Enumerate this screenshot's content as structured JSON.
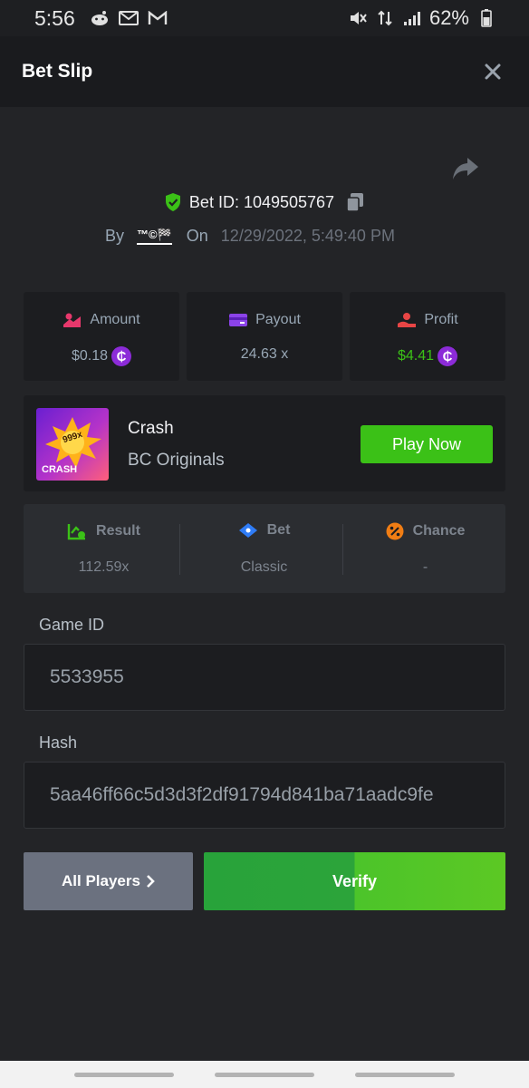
{
  "status_bar": {
    "time": "5:56",
    "battery_percent": "62%",
    "left_icons": [
      "reddit-icon",
      "gmail-icon",
      "gmail-icon"
    ],
    "right_icons": [
      "mute-icon",
      "data-icon",
      "signal-icon",
      "battery-icon"
    ]
  },
  "header": {
    "title": "Bet Slip"
  },
  "bet": {
    "id_text": "Bet ID: 1049505767",
    "by_label": "By",
    "username": "™©🏁",
    "on_label": "On",
    "date": "12/29/2022, 5:49:40 PM"
  },
  "stats": {
    "amount": {
      "label": "Amount",
      "value": "$0.18",
      "coin": "₵"
    },
    "payout": {
      "label": "Payout",
      "value": "24.63 x"
    },
    "profit": {
      "label": "Profit",
      "value": "$4.41",
      "coin": "₵"
    }
  },
  "game": {
    "name": "Crash",
    "provider": "BC Originals",
    "thumb_badge": "999x",
    "thumb_label": "CRASH",
    "play_label": "Play Now"
  },
  "result": {
    "result": {
      "label": "Result",
      "value": "112.59x"
    },
    "bet": {
      "label": "Bet",
      "value": "Classic"
    },
    "chance": {
      "label": "Chance",
      "value": "-"
    }
  },
  "game_id": {
    "label": "Game ID",
    "value": "5533955"
  },
  "hash": {
    "label": "Hash",
    "value": "5aa46ff66c5d3d3f2df91794d841ba71aadc9fe"
  },
  "actions": {
    "all_players": "All Players",
    "verify": "Verify"
  },
  "colors": {
    "background": "#232427",
    "header": "#1a1b1e",
    "card": "#1c1d20",
    "accent_green": "#3bc117",
    "coin_purple": "#8c2bd8"
  }
}
